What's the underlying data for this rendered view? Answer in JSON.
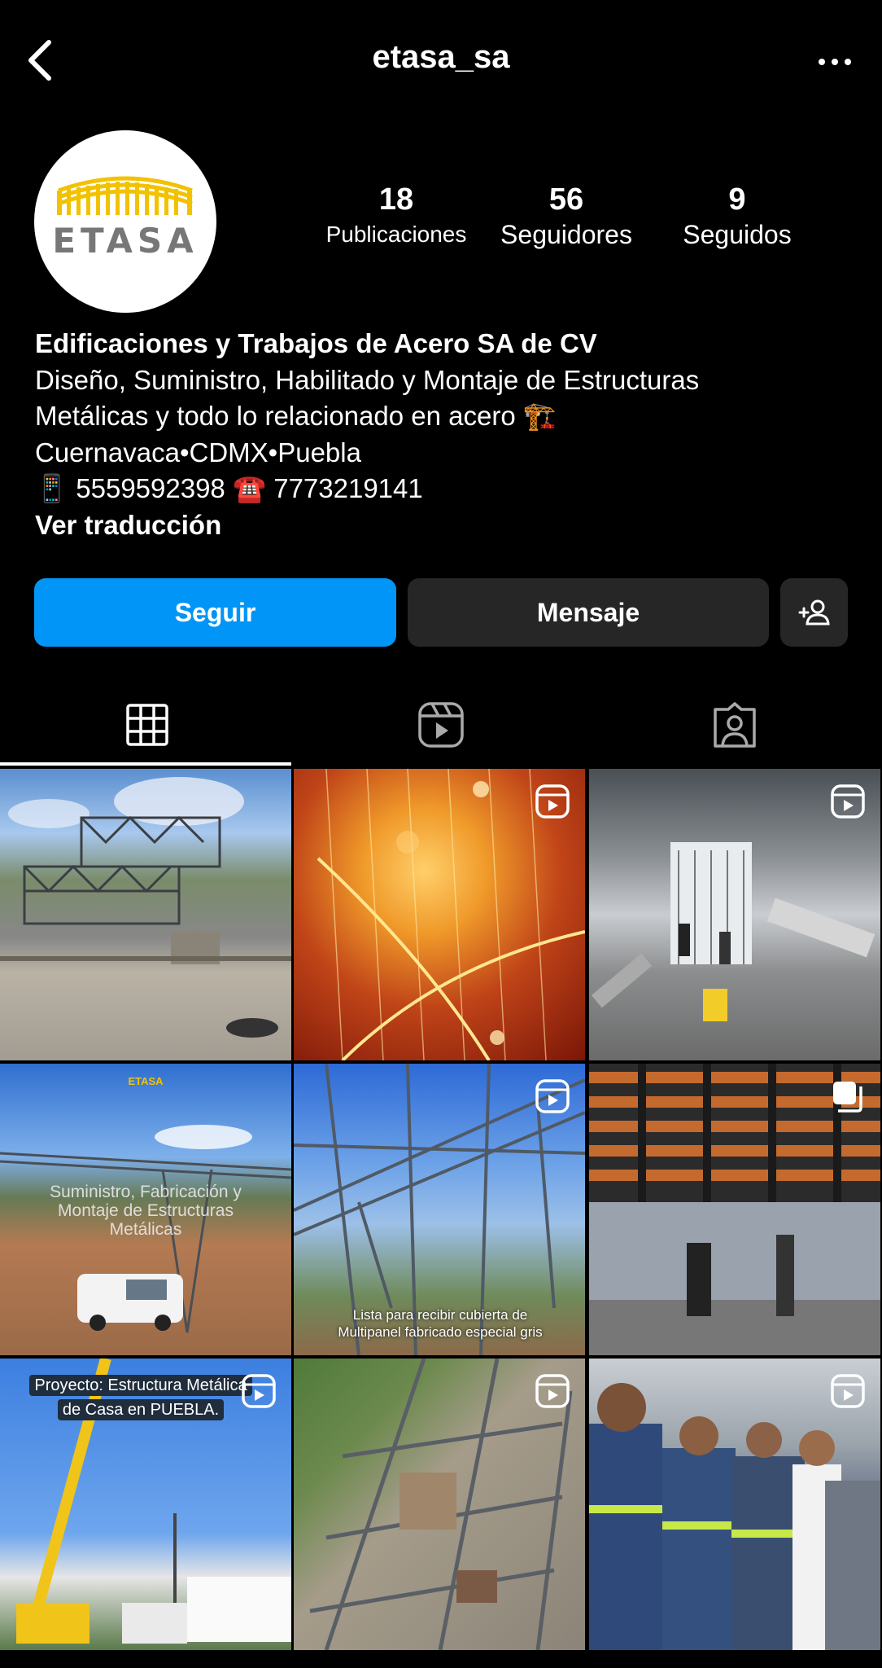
{
  "header": {
    "username": "etasa_sa"
  },
  "avatar": {
    "logo_text": "ETASA"
  },
  "stats": {
    "posts": {
      "value": "18",
      "label": "Publicaciones"
    },
    "followers": {
      "value": "56",
      "label": "Seguidores"
    },
    "following": {
      "value": "9",
      "label": "Seguidos"
    }
  },
  "bio": {
    "name": "Edificaciones y Trabajos de Acero SA de CV",
    "line1": "Diseño, Suministro, Habilitado y Montaje de Estructuras",
    "line2": "Metálicas y todo lo relacionado en acero 🏗️",
    "line3": "Cuernavaca•CDMX•Puebla",
    "line4": "📱 5559592398 ☎️ 7773219141",
    "translate": "Ver traducción"
  },
  "buttons": {
    "follow": "Seguir",
    "message": "Mensaje"
  },
  "tabs": [
    "grid-icon",
    "reels-icon",
    "tagged-icon"
  ],
  "posts": [
    {
      "kind": "photo",
      "caption": ""
    },
    {
      "kind": "reel",
      "caption": ""
    },
    {
      "kind": "reel",
      "caption": ""
    },
    {
      "kind": "photo",
      "caption": "Suministro, Fabricación y Montaje de Estructuras Metálicas",
      "logo": "ETASA"
    },
    {
      "kind": "reel",
      "caption": "Lista para recibir cubierta de Multipanel fabricado especial gris"
    },
    {
      "kind": "carousel",
      "caption": ""
    },
    {
      "kind": "reel",
      "caption": "Proyecto: Estructura Metálica de Casa en PUEBLA."
    },
    {
      "kind": "reel",
      "caption": ""
    },
    {
      "kind": "reel",
      "caption": ""
    }
  ],
  "colors": {
    "primary": "#0095f6",
    "secondary_button": "#262626",
    "background": "#000000",
    "logo_yellow": "#f2c200"
  }
}
